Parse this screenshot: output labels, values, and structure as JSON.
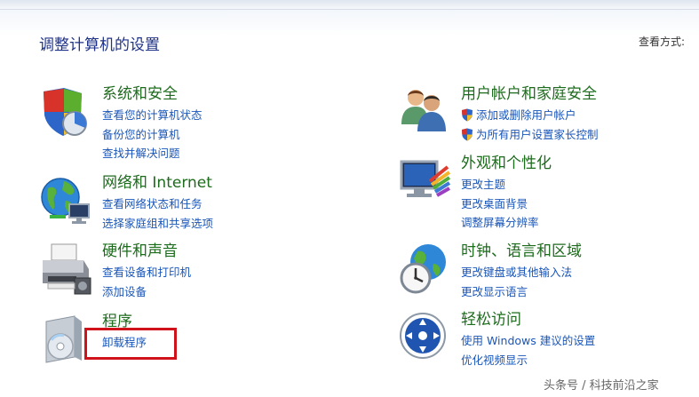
{
  "window": {
    "title": "调整计算机的设置",
    "view_by_label": "查看方式:"
  },
  "categories": [
    {
      "id": "system-security",
      "title": "系统和安全",
      "icon": "shield-icon",
      "links": [
        "查看您的计算机状态",
        "备份您的计算机",
        "查找并解决问题"
      ]
    },
    {
      "id": "network-internet",
      "title": "网络和 Internet",
      "icon": "network-globe-icon",
      "links": [
        "查看网络状态和任务",
        "选择家庭组和共享选项"
      ]
    },
    {
      "id": "hardware-sound",
      "title": "硬件和声音",
      "icon": "printer-icon",
      "links": [
        "查看设备和打印机",
        "添加设备"
      ]
    },
    {
      "id": "programs",
      "title": "程序",
      "icon": "programs-disc-icon",
      "links": [
        "卸载程序"
      ]
    },
    {
      "id": "user-accounts",
      "title": "用户帐户和家庭安全",
      "icon": "users-icon",
      "links": [
        "添加或删除用户帐户",
        "为所有用户设置家长控制"
      ]
    },
    {
      "id": "appearance",
      "title": "外观和个性化",
      "icon": "monitor-palette-icon",
      "links": [
        "更改主题",
        "更改桌面背景",
        "调整屏幕分辨率"
      ]
    },
    {
      "id": "clock-language",
      "title": "时钟、语言和区域",
      "icon": "clock-globe-icon",
      "links": [
        "更改键盘或其他输入法",
        "更改显示语言"
      ]
    },
    {
      "id": "ease-of-access",
      "title": "轻松访问",
      "icon": "ease-of-access-icon",
      "links": [
        "使用 Windows 建议的设置",
        "优化视频显示"
      ]
    }
  ],
  "watermark": "头条号 / 科技前沿之家",
  "colors": {
    "title_blue": "#1e3287",
    "category_green": "#1d6b1d",
    "link_blue": "#1a56b8",
    "highlight_red": "#d0131a"
  }
}
